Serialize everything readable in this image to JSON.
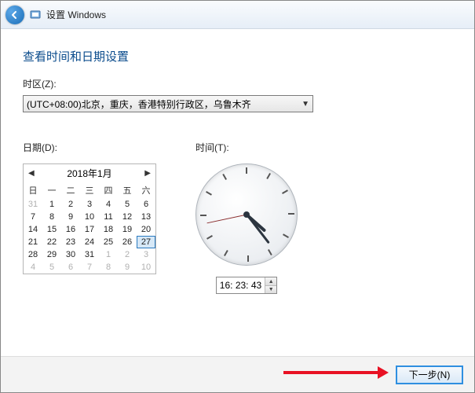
{
  "titlebar": {
    "title": "设置 Windows"
  },
  "main": {
    "heading": "查看时间和日期设置",
    "timezone_label": "时区(Z):",
    "timezone_value": "(UTC+08:00)北京，重庆，香港特别行政区，乌鲁木齐",
    "date_label": "日期(D):",
    "time_label": "时间(T):"
  },
  "calendar": {
    "month_title": "2018年1月",
    "dow": [
      "日",
      "一",
      "二",
      "三",
      "四",
      "五",
      "六"
    ],
    "weeks": [
      [
        {
          "d": 31,
          "o": true
        },
        {
          "d": 1
        },
        {
          "d": 2
        },
        {
          "d": 3
        },
        {
          "d": 4
        },
        {
          "d": 5
        },
        {
          "d": 6
        }
      ],
      [
        {
          "d": 7
        },
        {
          "d": 8
        },
        {
          "d": 9
        },
        {
          "d": 10
        },
        {
          "d": 11
        },
        {
          "d": 12
        },
        {
          "d": 13
        }
      ],
      [
        {
          "d": 14
        },
        {
          "d": 15
        },
        {
          "d": 16
        },
        {
          "d": 17
        },
        {
          "d": 18
        },
        {
          "d": 19
        },
        {
          "d": 20
        }
      ],
      [
        {
          "d": 21
        },
        {
          "d": 22
        },
        {
          "d": 23
        },
        {
          "d": 24
        },
        {
          "d": 25
        },
        {
          "d": 26
        },
        {
          "d": 27,
          "sel": true
        }
      ],
      [
        {
          "d": 28
        },
        {
          "d": 29
        },
        {
          "d": 30
        },
        {
          "d": 31
        },
        {
          "d": 1,
          "o": true
        },
        {
          "d": 2,
          "o": true
        },
        {
          "d": 3,
          "o": true
        }
      ],
      [
        {
          "d": 4,
          "o": true
        },
        {
          "d": 5,
          "o": true
        },
        {
          "d": 6,
          "o": true
        },
        {
          "d": 7,
          "o": true
        },
        {
          "d": 8,
          "o": true
        },
        {
          "d": 9,
          "o": true
        },
        {
          "d": 10,
          "o": true
        }
      ]
    ]
  },
  "time": {
    "value": "16: 23: 43",
    "h": 16,
    "m": 23,
    "s": 43
  },
  "footer": {
    "next_label": "下一步(N)"
  }
}
